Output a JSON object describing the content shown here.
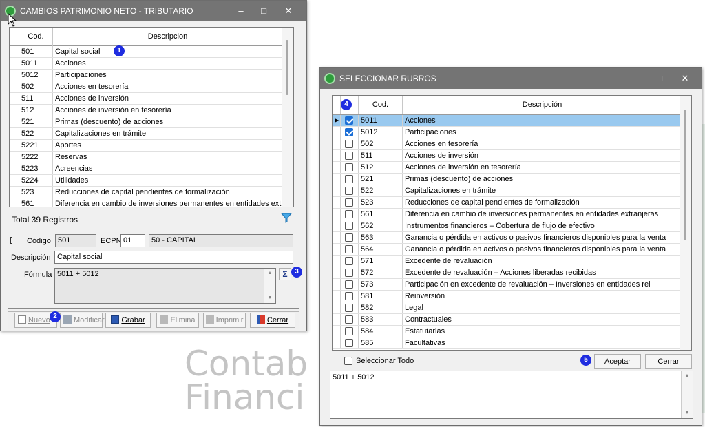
{
  "background": {
    "line1": "Contab",
    "line2": "Financi"
  },
  "window1": {
    "title": "CAMBIOS PATRIMONIO NETO - TRIBUTARIO",
    "controls": {
      "minimize": "–",
      "maximize": "□",
      "close": "✕"
    },
    "columns": [
      "Cod.",
      "Descripcion"
    ],
    "rows": [
      {
        "cod": "501",
        "desc": "Capital social"
      },
      {
        "cod": "5011",
        "desc": "Acciones"
      },
      {
        "cod": "5012",
        "desc": "Participaciones"
      },
      {
        "cod": "502",
        "desc": "Acciones en tesorería"
      },
      {
        "cod": "511",
        "desc": "Acciones de inversión"
      },
      {
        "cod": "512",
        "desc": "Acciones de inversión en tesorería"
      },
      {
        "cod": "521",
        "desc": "Primas (descuento) de acciones"
      },
      {
        "cod": "522",
        "desc": "Capitalizaciones en trámite"
      },
      {
        "cod": "5221",
        "desc": "Aportes"
      },
      {
        "cod": "5222",
        "desc": "Reservas"
      },
      {
        "cod": "5223",
        "desc": "Acreencias"
      },
      {
        "cod": "5224",
        "desc": "Utilidades"
      },
      {
        "cod": "523",
        "desc": "Reducciones de capital pendientes de formalización"
      },
      {
        "cod": "561",
        "desc": "Diferencia en cambio de inversiones permanentes en entidades extranjeras"
      }
    ],
    "total": "Total 39 Registros",
    "codigo_label": "Código",
    "codigo_value": "501",
    "ecpn_label": "ECPN",
    "ecpn_value": "01",
    "ecpn_desc": "50 - CAPITAL",
    "descripcion_label": "Descripción",
    "descripcion_value": "Capital social",
    "formula_label": "Fórmula",
    "formula_value": "5011 + 5012",
    "sigma": "Σ",
    "buttons": {
      "nuevo": "Nuevo",
      "modificar": "Modificar",
      "grabar": "Grabar",
      "elimina": "Elimina",
      "imprimir": "Imprimir",
      "cerrar": "Cerrar"
    }
  },
  "window2": {
    "title": "SELECCIONAR RUBROS",
    "controls": {
      "minimize": "–",
      "maximize": "□",
      "close": "✕"
    },
    "columns": [
      "Cod.",
      "Descripción"
    ],
    "rows": [
      {
        "checked": true,
        "cod": "5011",
        "desc": "Acciones"
      },
      {
        "checked": true,
        "cod": "5012",
        "desc": "Participaciones"
      },
      {
        "checked": false,
        "cod": "502",
        "desc": "Acciones en tesorería"
      },
      {
        "checked": false,
        "cod": "511",
        "desc": "Acciones de inversión"
      },
      {
        "checked": false,
        "cod": "512",
        "desc": "Acciones de inversión en tesorería"
      },
      {
        "checked": false,
        "cod": "521",
        "desc": "Primas (descuento) de acciones"
      },
      {
        "checked": false,
        "cod": "522",
        "desc": "Capitalizaciones en trámite"
      },
      {
        "checked": false,
        "cod": "523",
        "desc": "Reducciones de capital pendientes de formalización"
      },
      {
        "checked": false,
        "cod": "561",
        "desc": "Diferencia en cambio de inversiones permanentes en entidades extranjeras"
      },
      {
        "checked": false,
        "cod": "562",
        "desc": "Instrumentos financieros – Cobertura de flujo de efectivo"
      },
      {
        "checked": false,
        "cod": "563",
        "desc": "Ganancia o pérdida en activos o pasivos financieros disponibles para la venta"
      },
      {
        "checked": false,
        "cod": "564",
        "desc": "Ganancia o pérdida en activos o pasivos financieros disponibles para la venta"
      },
      {
        "checked": false,
        "cod": "571",
        "desc": "Excedente de revaluación"
      },
      {
        "checked": false,
        "cod": "572",
        "desc": "Excedente de revaluación – Acciones liberadas recibidas"
      },
      {
        "checked": false,
        "cod": "573",
        "desc": "Participación en excedente de revaluación – Inversiones en entidades rel"
      },
      {
        "checked": false,
        "cod": "581",
        "desc": "Reinversión"
      },
      {
        "checked": false,
        "cod": "582",
        "desc": "Legal"
      },
      {
        "checked": false,
        "cod": "583",
        "desc": "Contractuales"
      },
      {
        "checked": false,
        "cod": "584",
        "desc": "Estatutarias"
      },
      {
        "checked": false,
        "cod": "585",
        "desc": "Facultativas"
      }
    ],
    "select_all_label": "Seleccionar Todo",
    "aceptar": "Aceptar",
    "cerrar": "Cerrar",
    "formula_value": "5011 + 5012"
  },
  "badges": [
    "1",
    "2",
    "3",
    "4",
    "5"
  ],
  "colors": {
    "titlebar": "#747474",
    "selected_row": "#99c9ef",
    "badge": "#1f2de0",
    "check": "#1c6fd6"
  }
}
